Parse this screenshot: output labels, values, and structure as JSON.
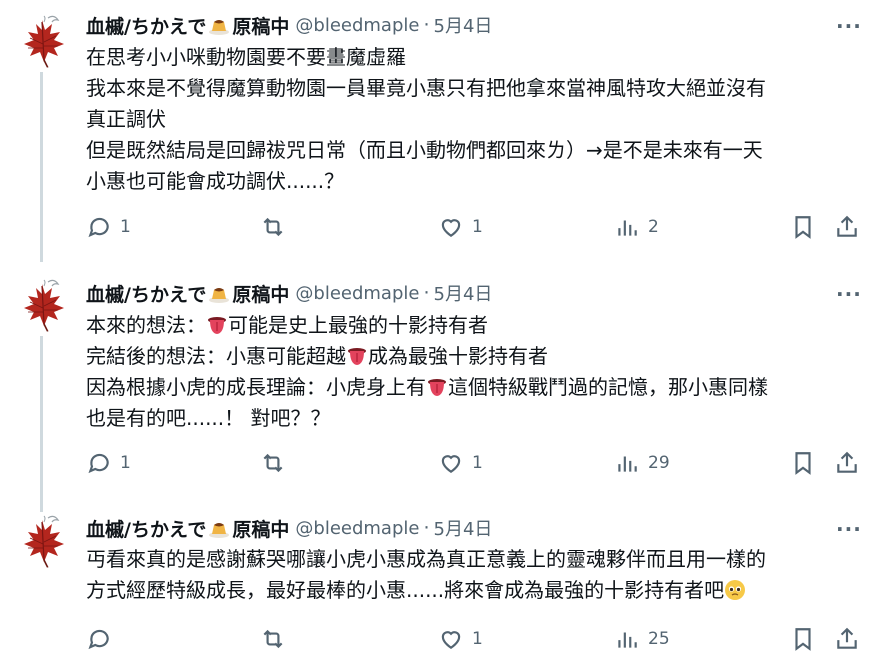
{
  "author": {
    "name": "血槭/ちかえで",
    "name_suffix": "原稿中",
    "handle": "@bleedmaple",
    "dot": "·"
  },
  "icons": {
    "more": "more-options-icon",
    "reply": "reply-icon",
    "retweet": "retweet-icon",
    "like": "heart-icon",
    "views": "views-chart-icon",
    "bookmark": "bookmark-icon",
    "share": "share-icon"
  },
  "colors": {
    "text": "#0f1419",
    "muted": "#536471",
    "thread_line": "#cfd9de",
    "accent_leaf": "#b3261e"
  },
  "tweets": [
    {
      "date": "5月4日",
      "lines": [
        "在思考小小咪動物園要不要畫魔虛羅",
        "我本來是不覺得魔算動物園一員畢竟小惠只有把他拿來當神風特攻大絕並沒有",
        "真正調伏",
        "但是既然結局是回歸祓咒日常（而且小動物們都回來ㄌ）→是不是未來有一天",
        "小惠也可能會成功調伏......？"
      ],
      "replies": "1",
      "retweets": "",
      "likes": "1",
      "views": "2"
    },
    {
      "date": "5月4日",
      "lines": [
        {
          "pre": "本來的想法：",
          "post": "可能是史上最強的十影持有者"
        },
        {
          "pre": "完結後的想法：小惠可能超越",
          "post": "成為最強十影持有者"
        },
        {
          "pre": "因為根據小虎的成長理論：小虎身上有",
          "post": "這個特級戰鬥過的記憶，那小惠同樣"
        },
        "也是有的吧......！ 對吧？？"
      ],
      "replies": "1",
      "retweets": "",
      "likes": "1",
      "views": "29"
    },
    {
      "date": "5月4日",
      "lines": [
        "丏看來真的是感謝蘇哭哪讓小虎小惠成為真正意義上的靈魂夥伴而且用一樣的",
        "方式經歷特級成長，最好最棒的小惠......將來會成為最強的十影持有者吧"
      ],
      "replies": "",
      "retweets": "",
      "likes": "1",
      "views": "25"
    }
  ]
}
